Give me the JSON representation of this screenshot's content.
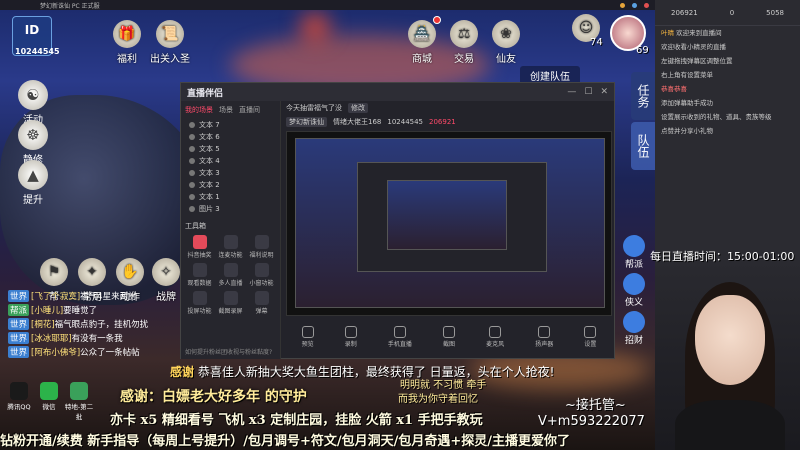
{
  "game": {
    "topbar_title": "梦幻新诛仙 PC 正式服",
    "account_id": "10244545",
    "buttons": {
      "fuli": "福利",
      "chuguan": "出关入圣",
      "shangcheng": "商城",
      "jiaoyi": "交易",
      "xianyou": "仙友",
      "huodong": "活动",
      "jingxiu": "静修",
      "tisheng": "提升",
      "bang": "帮",
      "changyong": "常用",
      "dongzuo": "动作",
      "zhanpai": "战牌"
    },
    "player_level": "74",
    "avatar_level": "69",
    "create_team": "创建队伍",
    "right_tabs": [
      "任务",
      "队伍"
    ],
    "overlay_buttons": [
      "帮派",
      "侠义",
      "招财"
    ],
    "chat": [
      {
        "tag": "世界",
        "name": "[飞了个寂寞]",
        "text": "福气4星来两討",
        "green": false
      },
      {
        "tag": "帮派",
        "name": "[小睡儿]",
        "text": "要睡觉了",
        "green": true
      },
      {
        "tag": "世界",
        "name": "[桐花]",
        "text": "福气眼点豹子，挂机勿扰",
        "green": false
      },
      {
        "tag": "世界",
        "name": "[冰冰耶耶]",
        "text": "有没有一条我",
        "green": false
      },
      {
        "tag": "世界",
        "name": "[阿布小佛爷]",
        "text": "公众了一条帖帖",
        "green": false
      }
    ]
  },
  "desktop_icons": [
    {
      "label": "腾讯QQ",
      "color": "#1a1a1a"
    },
    {
      "label": "微信",
      "color": "#2cb34a"
    },
    {
      "label": "特地-第二批",
      "color": "#3aa05a"
    }
  ],
  "overlay": {
    "scroll_prefix": "感谢",
    "scroll_text": "恭喜佳人新抽大奖大鱼生团柱，最终获得了 日量返，头在个人抢夜!",
    "thanks": "感谢：白嫖老大好多年 的守护",
    "mingming": "明明就 不习惯 牵手",
    "ersheng": "而我为你守着回忆",
    "line1": "亦卡 x5 精细看号  飞机 x3 定制庄园，挂脸  火箭 x1 手把手教玩",
    "line2": "钻粉开通/续费 新手指导（每周上号提升）/包月调号+符文/包月洞天/包月奇遇+探灵/主播更爱你了",
    "tuoguan": "~接托管~",
    "contact": "V+m593222077",
    "daily": "每日直播时间：15:00-01:00"
  },
  "obs": {
    "brand": "直播伴侣",
    "title_text": "今天抽雷福气了没",
    "title_tag": "修改",
    "tabs": [
      "我的场景",
      "场景",
      "直播间"
    ],
    "layers": [
      "文本 7",
      "文本 6",
      "文本 5",
      "文本 4",
      "文本 3",
      "文本 2",
      "文本 1",
      "图片 3"
    ],
    "tool_head": "工具箱",
    "tools": [
      {
        "label": "抖音抽奖",
        "red": true
      },
      {
        "label": "连麦功能",
        "red": false
      },
      {
        "label": "福利说明",
        "red": false
      },
      {
        "label": "观看数据",
        "red": false
      },
      {
        "label": "多人直播",
        "red": false
      },
      {
        "label": "小窗功能",
        "red": false
      },
      {
        "label": "投屏功能",
        "red": false
      },
      {
        "label": "截图录屏",
        "red": false
      },
      {
        "label": "弹幕",
        "red": false
      }
    ],
    "bottom_note": "如何提升粉丝团收视与粉丝黏度?",
    "info": {
      "account": "梦幻新诛仙",
      "name": "情绪大佬王168",
      "uid": "10244545",
      "fans": "206921"
    },
    "controls": [
      "预览",
      "录制",
      "手机直播",
      "截图",
      "麦克风",
      "扬声器",
      "设置"
    ]
  },
  "rpanel": {
    "stats": [
      "206921",
      "0",
      "5058"
    ],
    "messages": [
      {
        "user": "叶晴",
        "text": "欢迎来到直播间",
        "red": false
      },
      {
        "user": "",
        "text": "欢迎收看小精灵的直播",
        "red": false
      },
      {
        "user": "",
        "text": "左键拖拽弹幕区调整位置",
        "red": false
      },
      {
        "user": "",
        "text": "右上角有设置菜单",
        "red": false
      },
      {
        "user": "",
        "text": "恭喜恭喜",
        "red": true
      },
      {
        "user": "",
        "text": "添加弹幕助手成功",
        "red": false
      },
      {
        "user": "",
        "text": "设置展示收到的礼物、道具、贵族等级",
        "red": false
      },
      {
        "user": "",
        "text": "点赞并分享小礼物",
        "red": false
      }
    ]
  }
}
